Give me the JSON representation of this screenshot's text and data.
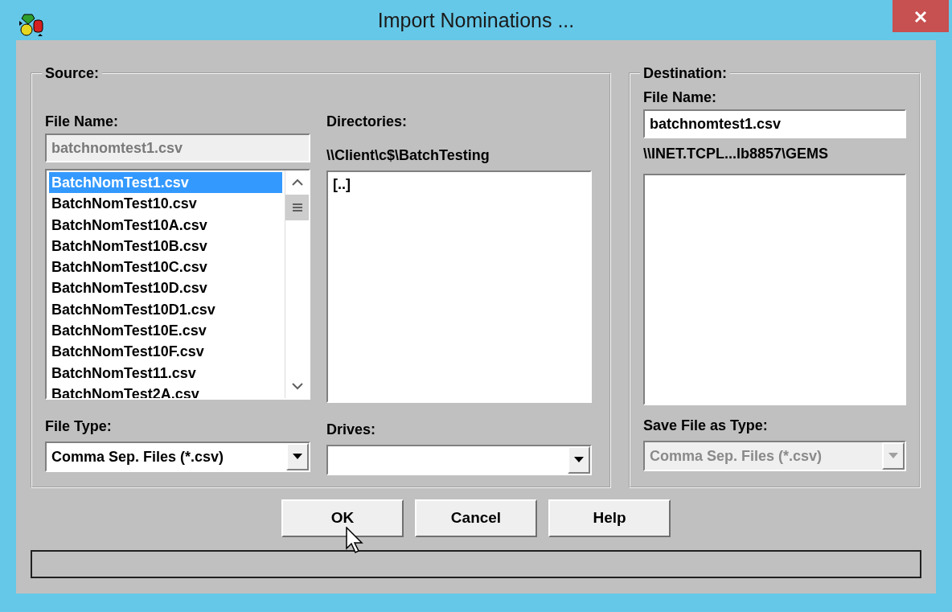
{
  "window": {
    "title": "Import Nominations ..."
  },
  "source": {
    "legend": "Source:",
    "file_name": {
      "label": "File Name:",
      "value": "batchnomtest1.csv",
      "disabled": true
    },
    "files": [
      {
        "name": "BatchNomTest1.csv",
        "selected": true
      },
      {
        "name": "BatchNomTest10.csv",
        "selected": false
      },
      {
        "name": "BatchNomTest10A.csv",
        "selected": false
      },
      {
        "name": "BatchNomTest10B.csv",
        "selected": false
      },
      {
        "name": "BatchNomTest10C.csv",
        "selected": false
      },
      {
        "name": "BatchNomTest10D.csv",
        "selected": false
      },
      {
        "name": "BatchNomTest10D1.csv",
        "selected": false
      },
      {
        "name": "BatchNomTest10E.csv",
        "selected": false
      },
      {
        "name": "BatchNomTest10F.csv",
        "selected": false
      },
      {
        "name": "BatchNomTest11.csv",
        "selected": false
      },
      {
        "name": "BatchNomTest2A.csv",
        "selected": false
      }
    ],
    "file_type": {
      "label": "File Type:",
      "value": "Comma Sep. Files (*.csv)",
      "disabled": false
    },
    "directories": {
      "label": "Directories:",
      "path": "\\\\Client\\c$\\BatchTesting",
      "items": [
        "[..]"
      ]
    },
    "drives": {
      "label": "Drives:"
    }
  },
  "destination": {
    "legend": "Destination:",
    "file_name": {
      "label": "File Name:",
      "value": "batchnomtest1.csv",
      "disabled": false
    },
    "path": "\\\\INET.TCPL...lb8857\\GEMS",
    "save_type": {
      "label": "Save File as Type:",
      "value": "Comma Sep. Files (*.csv)",
      "disabled": true
    }
  },
  "buttons": [
    {
      "label": "OK"
    },
    {
      "label": "Cancel"
    },
    {
      "label": "Help"
    }
  ]
}
